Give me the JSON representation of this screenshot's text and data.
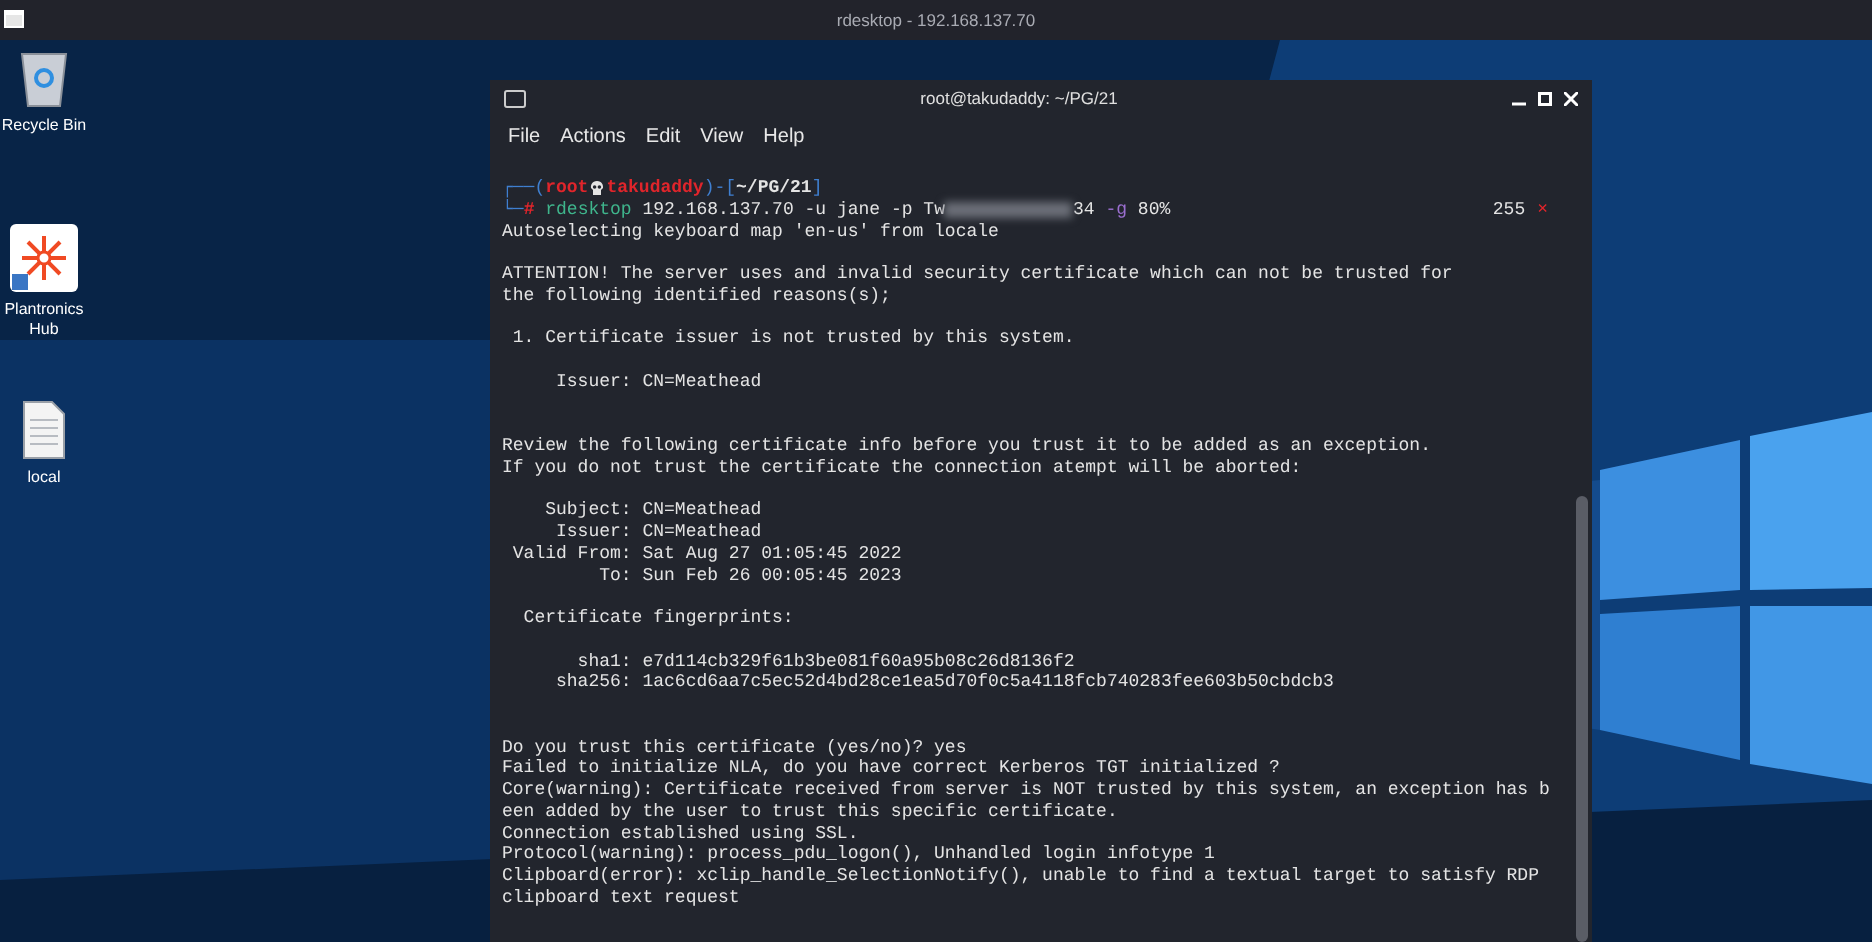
{
  "top_bar": {
    "title": "rdesktop - 192.168.137.70"
  },
  "desktop_icons": [
    {
      "kind": "recycle",
      "label": "Recycle Bin"
    },
    {
      "kind": "app",
      "label": "Plantronics Hub"
    },
    {
      "kind": "file",
      "label": "local"
    }
  ],
  "terminal": {
    "title": "root@takudaddy: ~/PG/21",
    "menu": [
      "File",
      "Actions",
      "Edit",
      "View",
      "Help"
    ],
    "prompt": {
      "frame_top": "┌──(",
      "separator": ")-[",
      "path_close": "]",
      "frame_bottom": "└─",
      "user": "root",
      "host": "takudaddy",
      "path": "~/PG/21",
      "symbol": "#",
      "command": "rdesktop",
      "args_before": "192.168.137.70 -u jane -p Tw",
      "args_after": "34",
      "flag": "-g",
      "flag_value": "80%",
      "exit_code": "255",
      "status_mark": "×"
    },
    "lines": [
      {
        "kind": "line",
        "text": "Autoselecting keyboard map 'en-us' from locale"
      },
      {
        "kind": "blank"
      },
      {
        "kind": "line",
        "text": "ATTENTION! The server uses and invalid security certificate which can not be trusted for"
      },
      {
        "kind": "line",
        "text": "the following identified reasons(s);"
      },
      {
        "kind": "blank"
      },
      {
        "kind": "line",
        "text": " 1. Certificate issuer is not trusted by this system."
      },
      {
        "kind": "blank"
      },
      {
        "kind": "line",
        "text": "     Issuer: CN=Meathead"
      },
      {
        "kind": "blank"
      },
      {
        "kind": "blank"
      },
      {
        "kind": "line",
        "text": "Review the following certificate info before you trust it to be added as an exception."
      },
      {
        "kind": "line",
        "text": "If you do not trust the certificate the connection atempt will be aborted:"
      },
      {
        "kind": "blank"
      },
      {
        "kind": "line",
        "text": "    Subject: CN=Meathead"
      },
      {
        "kind": "line",
        "text": "     Issuer: CN=Meathead"
      },
      {
        "kind": "line",
        "text": " Valid From: Sat Aug 27 01:05:45 2022"
      },
      {
        "kind": "line",
        "text": "         To: Sun Feb 26 00:05:45 2023"
      },
      {
        "kind": "blank"
      },
      {
        "kind": "line",
        "text": "  Certificate fingerprints:"
      },
      {
        "kind": "blank"
      },
      {
        "kind": "line",
        "text": "       sha1: e7d114cb329f61b3be081f60a95b08c26d8136f2"
      },
      {
        "kind": "line",
        "text": "     sha256: 1ac6cd6aa7c5ec52d4bd28ce1ea5d70f0c5a4118fcb740283fee603b50cbdcb3"
      },
      {
        "kind": "blank"
      },
      {
        "kind": "blank"
      },
      {
        "kind": "line",
        "text": "Do you trust this certificate (yes/no)? yes"
      },
      {
        "kind": "line",
        "text": "Failed to initialize NLA, do you have correct Kerberos TGT initialized ?"
      },
      {
        "kind": "line",
        "text": "Core(warning): Certificate received from server is NOT trusted by this system, an exception has b"
      },
      {
        "kind": "line",
        "text": "een added by the user to trust this specific certificate."
      },
      {
        "kind": "line",
        "text": "Connection established using SSL."
      },
      {
        "kind": "line",
        "text": "Protocol(warning): process_pdu_logon(), Unhandled login infotype 1"
      },
      {
        "kind": "line",
        "text": "Clipboard(error): xclip_handle_SelectionNotify(), unable to find a textual target to satisfy RDP"
      },
      {
        "kind": "line",
        "text": "clipboard text request"
      }
    ]
  }
}
